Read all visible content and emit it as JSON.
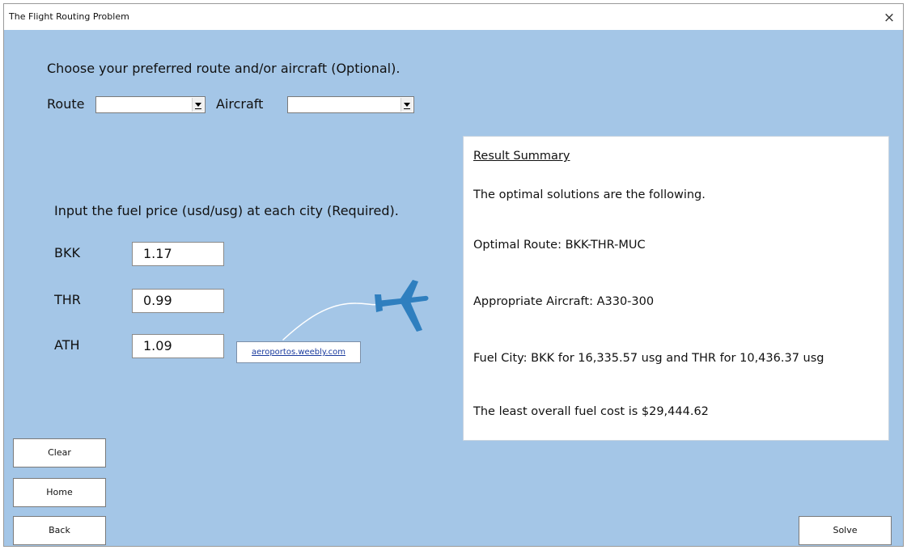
{
  "window": {
    "title": "The Flight Routing Problem",
    "close_glyph": "×"
  },
  "selection": {
    "heading": "Choose your preferred route and/or aircraft (Optional).",
    "route_label": "Route",
    "route_value": "",
    "aircraft_label": "Aircraft",
    "aircraft_value": ""
  },
  "fuel": {
    "heading": "Input the fuel price (usd/usg) at each city (Required).",
    "cities": [
      {
        "code": "BKK",
        "price": "1.17"
      },
      {
        "code": "THR",
        "price": "0.99"
      },
      {
        "code": "ATH",
        "price": "1.09"
      }
    ],
    "link_text": "aeroportos.weebly.com"
  },
  "result": {
    "title": "Result Summary",
    "intro": "The optimal solutions are the following.",
    "route": "Optimal Route: BKK-THR-MUC",
    "aircraft": "Appropriate Aircraft: A330-300",
    "fuel_city": "Fuel City: BKK for 16,335.57 usg and THR for 10,436.37 usg",
    "cost": "The least overall fuel cost is $29,444.62"
  },
  "buttons": {
    "clear": "Clear",
    "home": "Home",
    "back": "Back",
    "solve": "Solve"
  },
  "colors": {
    "form_background": "#a4c6e7",
    "plane": "#2f7fbf"
  },
  "icons": {
    "plane": "airplane-icon",
    "close": "close-icon",
    "dropdown": "chevron-down-icon"
  }
}
